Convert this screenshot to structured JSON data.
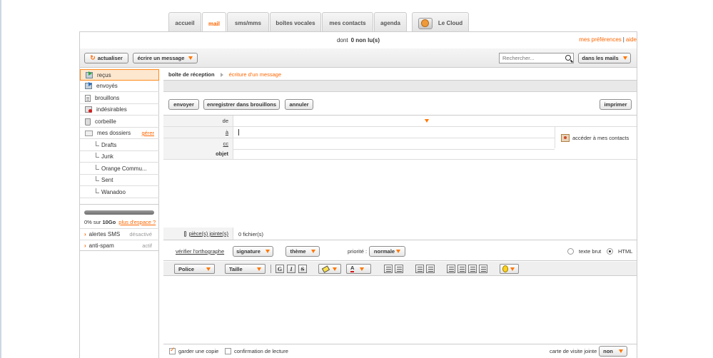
{
  "tabs": [
    {
      "label": "accueil"
    },
    {
      "label": "mail"
    },
    {
      "label": "sms/mms"
    },
    {
      "label": "boîtes vocales"
    },
    {
      "label": "mes contacts"
    },
    {
      "label": "agenda"
    }
  ],
  "cloud_tab": {
    "label": "Le Cloud"
  },
  "header": {
    "unread_prefix": "dont",
    "unread_count": "0 non lu(s)",
    "preferences": "mes préférences",
    "separator": "|",
    "help": "aide"
  },
  "toolbar": {
    "refresh": "actualiser",
    "compose": "écrire un message",
    "search_placeholder": "Rechercher...",
    "scope": "dans les mails"
  },
  "sidebar": {
    "folders": [
      {
        "label": "reçus",
        "icon": "inbox-icon"
      },
      {
        "label": "envoyés",
        "icon": "sent-icon"
      },
      {
        "label": "brouillons",
        "icon": "draft-icon"
      },
      {
        "label": "indésirables",
        "icon": "spam-icon"
      },
      {
        "label": "corbeille",
        "icon": "trash-icon"
      }
    ],
    "my_folders": "mes dossiers",
    "manage": "gérer",
    "subfolders": [
      "Drafts",
      "Junk",
      "Orange Commu...",
      "Sent",
      "Wanadoo"
    ],
    "quota": {
      "used": "0% sur",
      "total": "10Go",
      "more": "plus d'espace ?",
      "fraction": 0
    },
    "options": [
      {
        "label": "alertes SMS",
        "state": "désactivé"
      },
      {
        "label": "anti-spam",
        "state": "actif"
      }
    ]
  },
  "content": {
    "breadcrumb": [
      "boîte de réception",
      "écriture d'un message"
    ],
    "actions": {
      "send": "envoyer",
      "save_draft": "enregistrer dans brouillons",
      "cancel": "annuler",
      "print": "imprimer"
    },
    "fields": {
      "from": "de",
      "to": "à",
      "cc": "cc",
      "subject": "objet",
      "contacts": "accéder à mes contacts"
    },
    "attachments": {
      "label": "pièce(s) jointe(s)",
      "count": "0 fichier(s)"
    },
    "options": {
      "spellcheck": "vérifier l'orthographe",
      "signature": "signature",
      "theme": "thème",
      "priority_label": "priorité :",
      "priority_value": "normale",
      "plain_text": "texte brut",
      "html": "HTML"
    },
    "format": {
      "font": "Police",
      "size": "Taille",
      "bold": "G",
      "italic": "I",
      "strike": "S",
      "text_color": "A"
    },
    "bottom": {
      "keep_copy": "garder une copie",
      "read_receipt": "confirmation de lecture",
      "vcard_label": "carte de visite jointe",
      "vcard_value": "non"
    }
  },
  "colors": {
    "accent": "#ff6600",
    "active_bg": "#fde7cf"
  }
}
